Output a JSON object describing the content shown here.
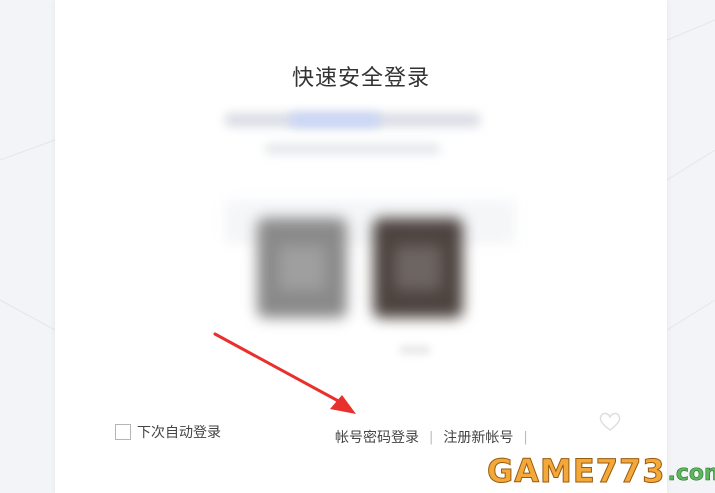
{
  "login": {
    "title": "快速安全登录",
    "auto_login_label": "下次自动登录",
    "account_login_link": "帐号密码登录",
    "register_link": "注册新帐号",
    "separator": "|"
  },
  "watermark": {
    "main": "GAME773",
    "domain": ".com"
  },
  "annotation": {
    "arrow_color": "#e8302c"
  },
  "icons": {
    "decorative": "heart-outline-icon"
  }
}
